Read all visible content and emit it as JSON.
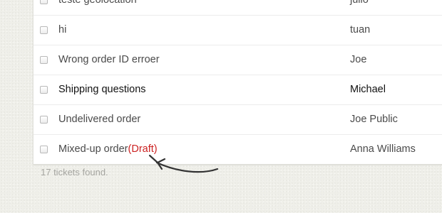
{
  "tickets": [
    {
      "subject": "teste geolocation",
      "draft_label": "",
      "requester": "julio",
      "unread": false
    },
    {
      "subject": "hi",
      "draft_label": "",
      "requester": "tuan",
      "unread": false
    },
    {
      "subject": "Wrong order ID erroer",
      "draft_label": "",
      "requester": "Joe",
      "unread": false
    },
    {
      "subject": "Shipping questions",
      "draft_label": "",
      "requester": "Michael",
      "unread": true
    },
    {
      "subject": "Undelivered order",
      "draft_label": "",
      "requester": "Joe Public",
      "unread": false
    },
    {
      "subject": "Mixed-up order",
      "draft_label": "(Draft)",
      "requester": "Anna Williams",
      "unread": false
    }
  ],
  "footer": {
    "tickets_found": "17 tickets found."
  },
  "colors": {
    "draft": "#cc2222",
    "background": "#efefe9",
    "arrow": "#333333"
  },
  "icons": {
    "pointer": "curved-arrow-icon"
  }
}
